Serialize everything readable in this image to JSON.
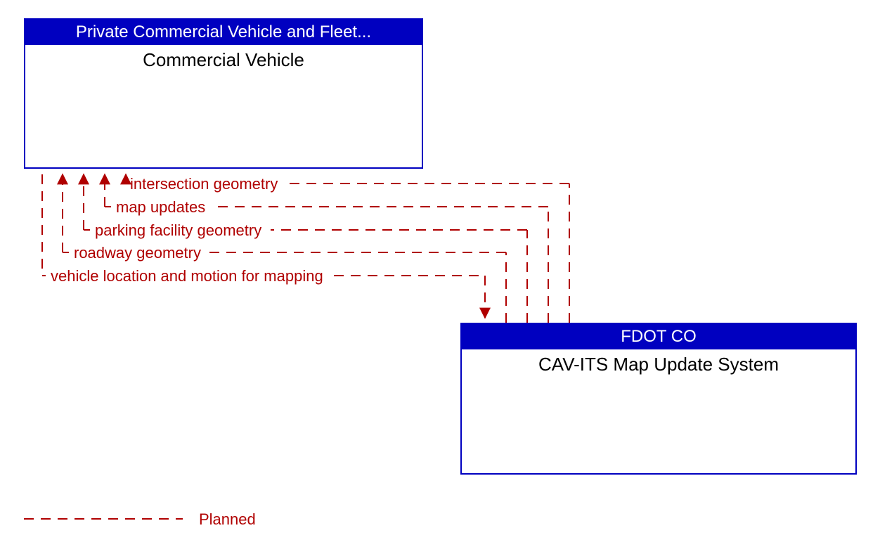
{
  "boxes": {
    "top": {
      "header": "Private Commercial Vehicle and Fleet...",
      "title": "Commercial Vehicle"
    },
    "bottom": {
      "header": "FDOT CO",
      "title": "CAV-ITS Map Update System"
    }
  },
  "flows": {
    "f1": "intersection geometry",
    "f2": "map updates",
    "f3": "parking facility geometry",
    "f4": "roadway geometry",
    "f5": "vehicle location and motion for mapping"
  },
  "legend": {
    "planned": "Planned"
  },
  "colors": {
    "planned_line": "#b00000",
    "box_border": "#0000c0"
  }
}
